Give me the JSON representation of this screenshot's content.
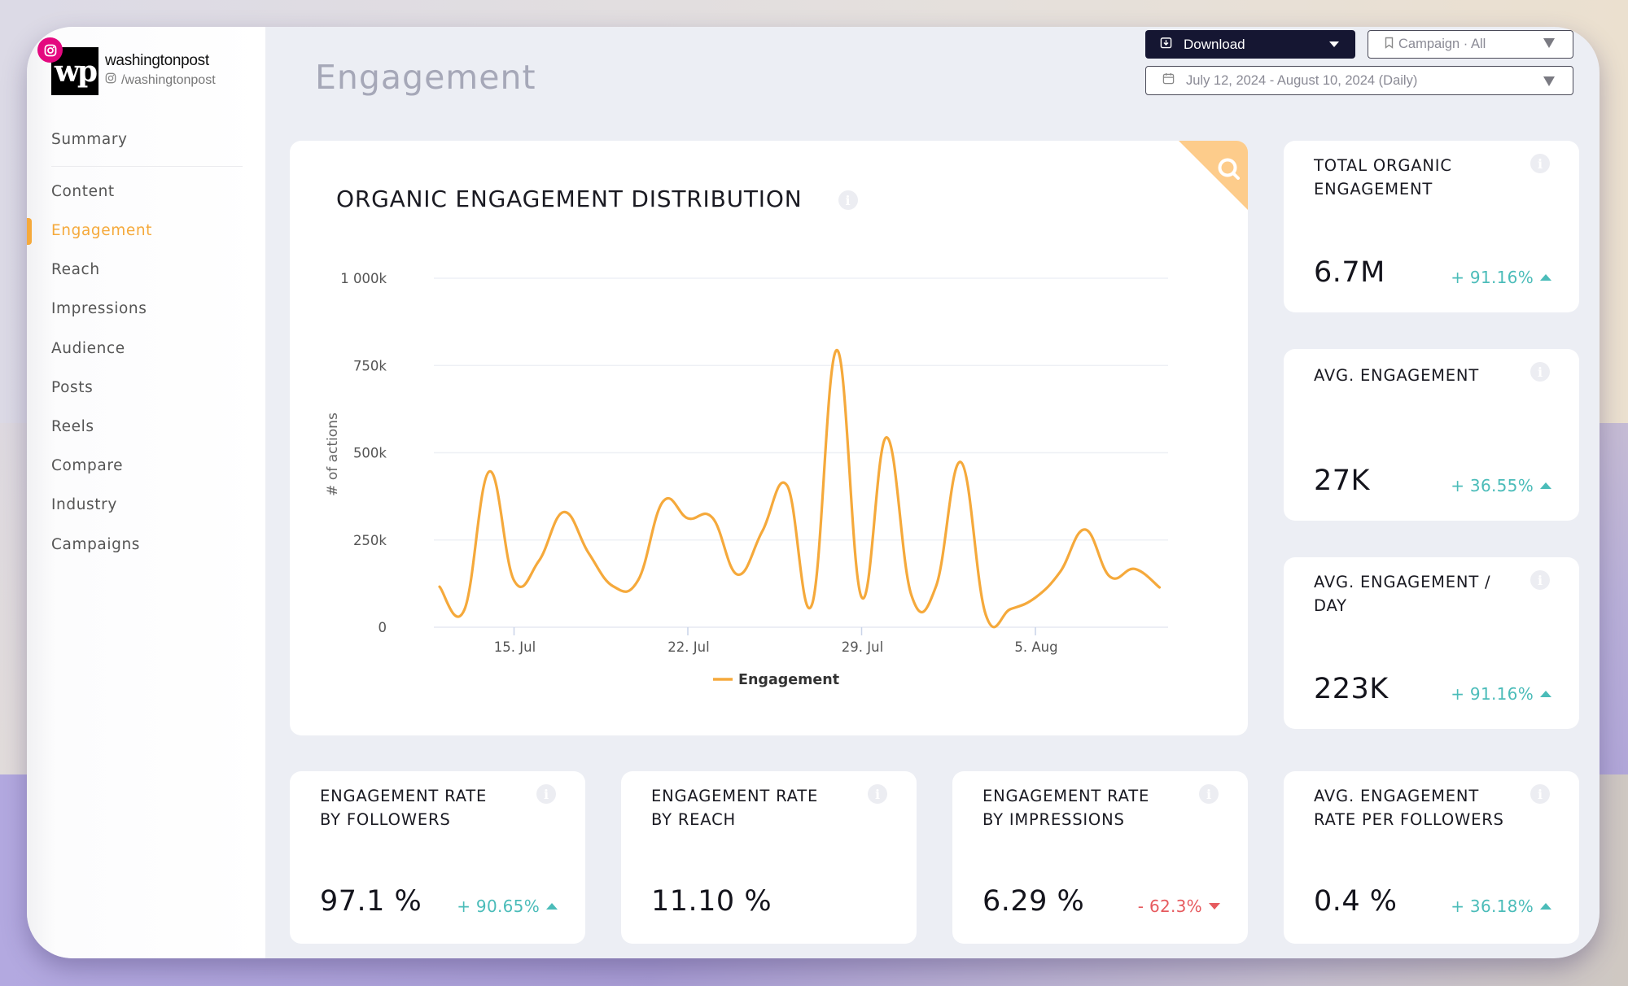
{
  "account": {
    "name": "washingtonpost",
    "handle": "/washingtonpost",
    "logo_text": "wp",
    "platform": "instagram"
  },
  "sidebar": {
    "items": [
      {
        "label": "Summary",
        "active": false
      },
      {
        "label": "Content",
        "active": false
      },
      {
        "label": "Engagement",
        "active": true
      },
      {
        "label": "Reach",
        "active": false
      },
      {
        "label": "Impressions",
        "active": false
      },
      {
        "label": "Audience",
        "active": false
      },
      {
        "label": "Posts",
        "active": false
      },
      {
        "label": "Reels",
        "active": false
      },
      {
        "label": "Compare",
        "active": false
      },
      {
        "label": "Industry",
        "active": false
      },
      {
        "label": "Campaigns",
        "active": false
      }
    ]
  },
  "header": {
    "title": "Engagement",
    "download_label": "Download",
    "campaign_label": "Campaign · All",
    "date_range": "July 12, 2024 - August 10, 2024 (Daily)"
  },
  "colors": {
    "accent": "#f5a93b",
    "positive": "#4bbcb9",
    "negative": "#e65a5e",
    "dark_button": "#151632",
    "instagram": "#e4087f",
    "ribbon": "#fdcc8b"
  },
  "chart_card": {
    "title": "ORGANIC ENGAGEMENT DISTRIBUTION",
    "corner_icon": "search-icon"
  },
  "chart_data": {
    "type": "line",
    "title": "ORGANIC ENGAGEMENT DISTRIBUTION",
    "xlabel": "",
    "ylabel": "# of actions",
    "ylim": [
      0,
      1000000
    ],
    "yticks": [
      0,
      250000,
      500000,
      750000,
      1000000
    ],
    "ytick_labels": [
      "0",
      "250k",
      "500k",
      "750k",
      "1 000k"
    ],
    "x_start": "2024-07-12",
    "x": [
      "Jul 12",
      "Jul 13",
      "Jul 14",
      "Jul 15",
      "Jul 16",
      "Jul 17",
      "Jul 18",
      "Jul 19",
      "Jul 20",
      "Jul 21",
      "Jul 22",
      "Jul 23",
      "Jul 24",
      "Jul 25",
      "Jul 26",
      "Jul 27",
      "Jul 28",
      "Jul 29",
      "Jul 30",
      "Jul 31",
      "Aug 1",
      "Aug 2",
      "Aug 3",
      "Aug 4",
      "Aug 5",
      "Aug 6",
      "Aug 7",
      "Aug 8",
      "Aug 9",
      "Aug 10"
    ],
    "xticks": [
      {
        "day_index": 3,
        "label": "15. Jul"
      },
      {
        "day_index": 10,
        "label": "22. Jul"
      },
      {
        "day_index": 17,
        "label": "29. Jul"
      },
      {
        "day_index": 24,
        "label": "5. Aug"
      }
    ],
    "grid": true,
    "legend_position": "bottom-center",
    "series": [
      {
        "name": "Engagement",
        "color": "#f5a93b",
        "values": [
          116000,
          50000,
          446000,
          134000,
          190000,
          330000,
          213000,
          117000,
          135000,
          360000,
          312000,
          313000,
          151000,
          275000,
          406000,
          65000,
          794000,
          86000,
          544000,
          93000,
          118000,
          473000,
          36000,
          52000,
          85000,
          159000,
          280000,
          145000,
          167000,
          114000
        ]
      }
    ]
  },
  "kpis_right": [
    {
      "label": "TOTAL ORGANIC ENGAGEMENT",
      "value": "6.7M",
      "delta": "+ 91.16%",
      "direction": "up"
    },
    {
      "label": "AVG. ENGAGEMENT",
      "value": "27K",
      "delta": "+ 36.55%",
      "direction": "up"
    },
    {
      "label": "AVG. ENGAGEMENT / DAY",
      "value": "223K",
      "delta": "+ 91.16%",
      "direction": "up"
    }
  ],
  "kpis_bottom": [
    {
      "label": "ENGAGEMENT RATE BY FOLLOWERS",
      "value": "97.1 %",
      "delta": "+ 90.65%",
      "direction": "up"
    },
    {
      "label": "ENGAGEMENT RATE BY REACH",
      "value": "11.10 %",
      "delta": "",
      "direction": "none"
    },
    {
      "label": "ENGAGEMENT RATE BY IMPRESSIONS",
      "value": "6.29 %",
      "delta": "- 62.3%",
      "direction": "down"
    },
    {
      "label": "AVG. ENGAGEMENT RATE PER FOLLOWERS",
      "value": "0.4 %",
      "delta": "+ 36.18%",
      "direction": "up"
    }
  ]
}
